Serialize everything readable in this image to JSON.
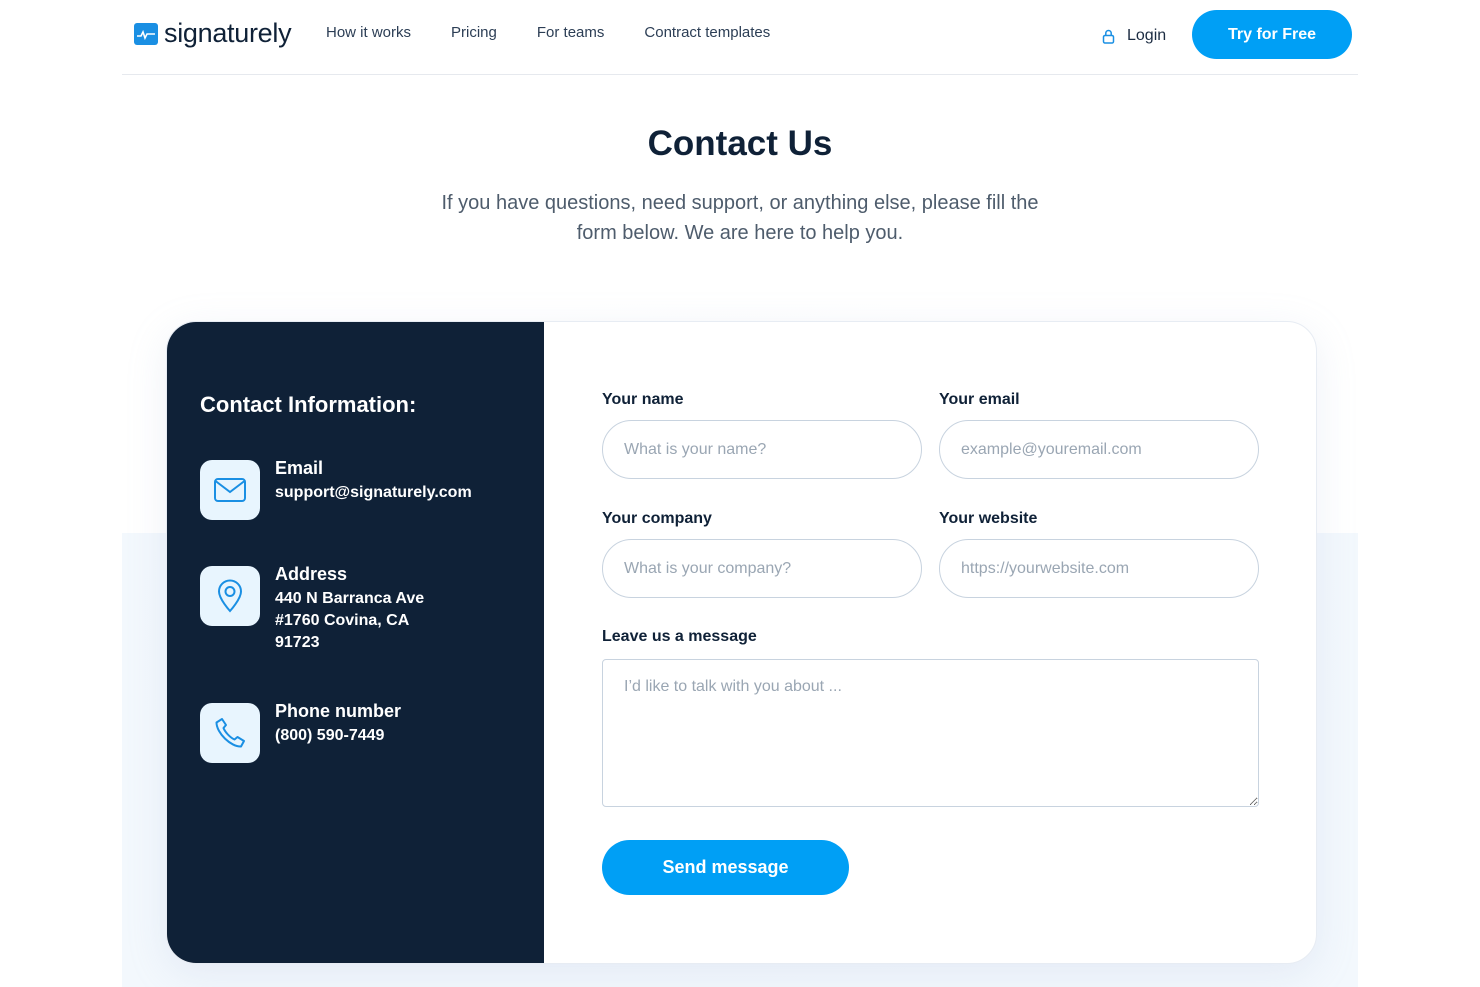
{
  "header": {
    "logo_text": "signaturely",
    "nav": [
      "How it works",
      "Pricing",
      "For teams",
      "Contract templates"
    ],
    "login_label": "Login",
    "cta_label": "Try for Free"
  },
  "hero": {
    "title": "Contact Us",
    "subtitle": "If you have questions, need support, or anything else, please fill the form below. We are here to help you."
  },
  "contact_info": {
    "title": "Contact Information:",
    "email": {
      "label": "Email",
      "value": "support@signaturely.com",
      "icon": "mail-icon"
    },
    "address": {
      "label": "Address",
      "value": "440 N Barranca Ave #1760 Covina, CA 91723",
      "icon": "location-pin-icon"
    },
    "phone": {
      "label": "Phone number",
      "value": "(800) 590-7449",
      "icon": "phone-icon"
    }
  },
  "form": {
    "name": {
      "label": "Your name",
      "placeholder": "What is your name?"
    },
    "email": {
      "label": "Your email",
      "placeholder": "example@youremail.com"
    },
    "company": {
      "label": "Your company",
      "placeholder": "What is your company?"
    },
    "website": {
      "label": "Your website",
      "placeholder": "https://yourwebsite.com"
    },
    "message": {
      "label": "Leave us a message",
      "placeholder": "I’d like to talk with you about ..."
    },
    "submit_label": "Send message"
  },
  "colors": {
    "accent": "#009ff5",
    "navy": "#0f2137"
  }
}
